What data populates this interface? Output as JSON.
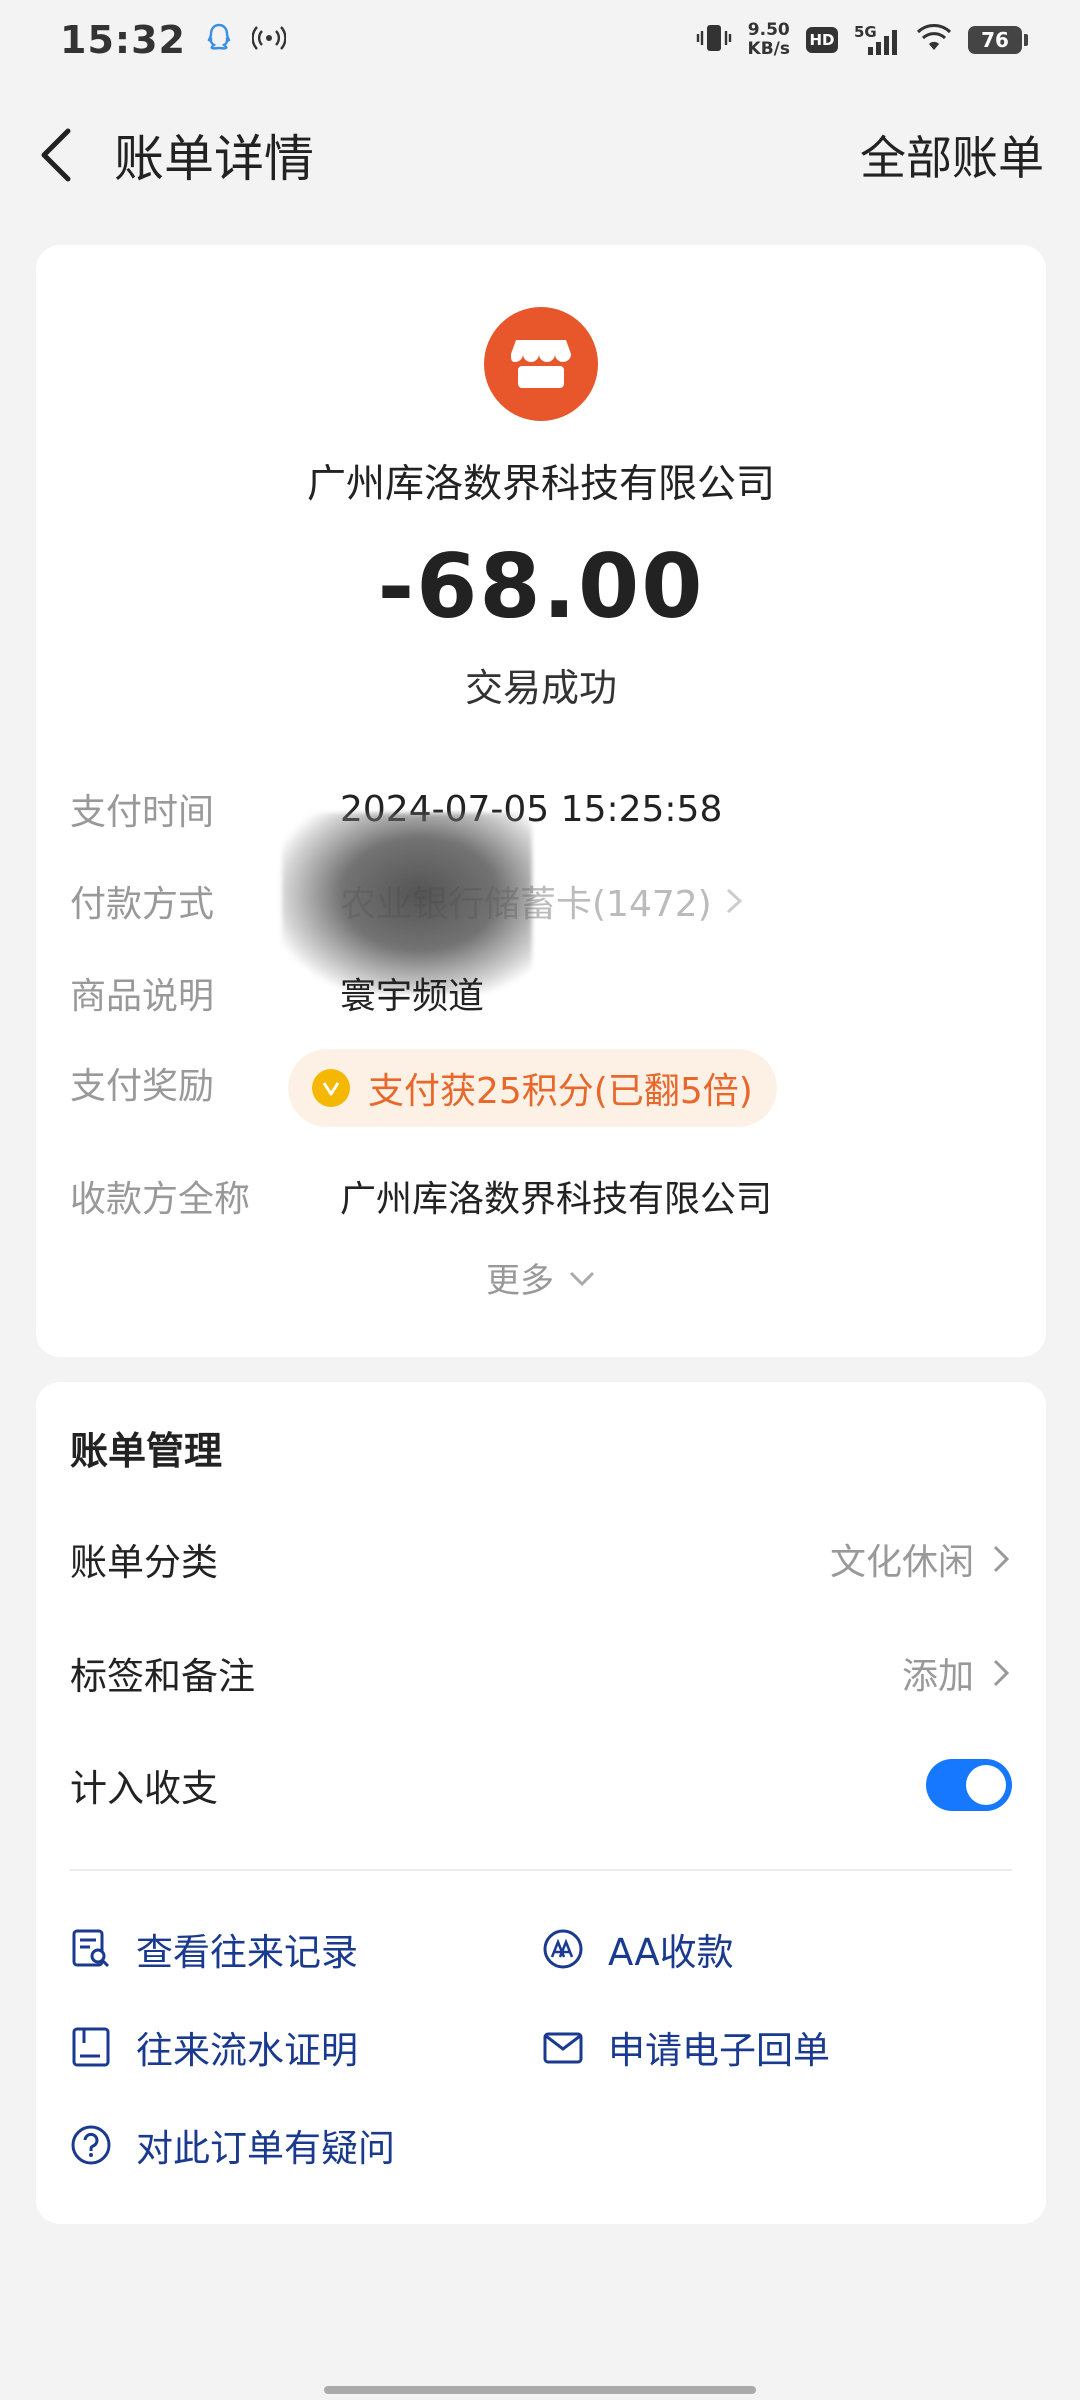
{
  "status_bar": {
    "time": "15:32",
    "net_speed_value": "9.50",
    "net_speed_unit": "KB/s",
    "hd": "HD",
    "signal": "5G",
    "battery": "76"
  },
  "nav": {
    "title": "账单详情",
    "right_link": "全部账单"
  },
  "transaction": {
    "merchant": "广州库洛数界科技有限公司",
    "amount": "-68.00",
    "status": "交易成功",
    "details": [
      {
        "label": "支付时间",
        "value": "2024-07-05 15:25:58"
      },
      {
        "label": "付款方式",
        "value": "农业银行储蓄卡(1472)"
      },
      {
        "label": "商品说明",
        "value": "寰宇频道"
      },
      {
        "label": "支付奖励",
        "value": "支付获25积分(已翻5倍)"
      },
      {
        "label": "收款方全称",
        "value": "广州库洛数界科技有限公司"
      }
    ],
    "more": "更多"
  },
  "management": {
    "title": "账单管理",
    "category": {
      "label": "账单分类",
      "value": "文化休闲"
    },
    "tags": {
      "label": "标签和备注",
      "value": "添加"
    },
    "count_in": {
      "label": "计入收支",
      "enabled": true
    },
    "actions": [
      {
        "label": "查看往来记录",
        "icon": "record-search-icon"
      },
      {
        "label": "AA收款",
        "icon": "aa-icon"
      },
      {
        "label": "往来流水证明",
        "icon": "statement-icon"
      },
      {
        "label": "申请电子回单",
        "icon": "mail-icon"
      },
      {
        "label": "对此订单有疑问",
        "icon": "question-icon"
      }
    ]
  },
  "colors": {
    "accent_blue": "#1677ff",
    "link_blue": "#1a3a8f",
    "merchant_orange": "#e8572b",
    "reward_orange": "#e8682b"
  }
}
